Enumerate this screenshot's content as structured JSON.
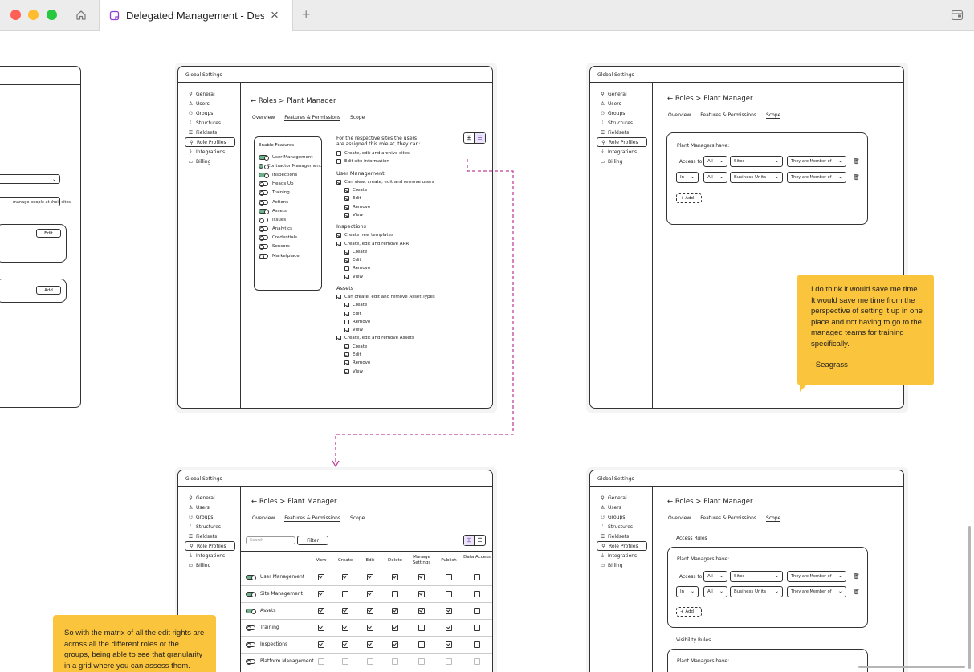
{
  "window": {
    "tab_title": "Delegated Management - Design",
    "colors": {
      "close": "#fe5f57",
      "minimize": "#febc2e",
      "zoom": "#28c840",
      "note": "#fbc43d",
      "connector": "#c0419b"
    }
  },
  "left_partial": {
    "select_text": "",
    "input_text": "manage people at their sites",
    "edit_label": "Edit",
    "add_label": "Add"
  },
  "sidebar": {
    "header": "Global Settings",
    "items": [
      "General",
      "Users",
      "Groups",
      "Structures",
      "Fieldsets",
      "Role Profiles",
      "Integrations",
      "Billing"
    ],
    "selected": "Role Profiles"
  },
  "frame1": {
    "breadcrumb": "← Roles > Plant Manager",
    "tabs": [
      "Overview",
      "Features & Permissions",
      "Scope"
    ],
    "active_tab": "Features & Permissions",
    "features_title": "Enable Features",
    "features": [
      {
        "label": "User Management",
        "on": true
      },
      {
        "label": "Contractor Management",
        "on": true
      },
      {
        "label": "Inspections",
        "on": true
      },
      {
        "label": "Heads Up",
        "on": false
      },
      {
        "label": "Training",
        "on": false
      },
      {
        "label": "Actions",
        "on": false
      },
      {
        "label": "Assets",
        "on": true
      },
      {
        "label": "Issues",
        "on": false
      },
      {
        "label": "Analytics",
        "on": false
      },
      {
        "label": "Credentials",
        "on": false
      },
      {
        "label": "Sensors",
        "on": false
      },
      {
        "label": "Marketplace",
        "on": false
      }
    ],
    "intro_line1": "For the respective sites the users",
    "intro_line2": "are assigned this role at, they can:",
    "site_perms": [
      {
        "label": "Create, edit and archive sites",
        "checked": false
      },
      {
        "label": "Edit site information",
        "checked": false
      }
    ],
    "sections": [
      {
        "title": "User Management",
        "groups": [
          {
            "label": "Can view, create, edit and remove users",
            "checked": true,
            "subs": [
              {
                "label": "Create",
                "checked": true
              },
              {
                "label": "Edit",
                "checked": true
              },
              {
                "label": "Remove",
                "checked": true
              },
              {
                "label": "View",
                "checked": true
              }
            ]
          }
        ]
      },
      {
        "title": "Inspections",
        "groups": [
          {
            "label": "Create new templates",
            "checked": true,
            "subs": []
          },
          {
            "label": "Create, edit and remove ARR",
            "checked": true,
            "subs": [
              {
                "label": "Create",
                "checked": true
              },
              {
                "label": "Edit",
                "checked": true
              },
              {
                "label": "Remove",
                "checked": false
              },
              {
                "label": "View",
                "checked": true
              }
            ]
          }
        ]
      },
      {
        "title": "Assets",
        "groups": [
          {
            "label": "Can create, edit and remove Asset Types",
            "checked": true,
            "subs": [
              {
                "label": "Create",
                "checked": true
              },
              {
                "label": "Edit",
                "checked": true
              },
              {
                "label": "Remove",
                "checked": false
              },
              {
                "label": "View",
                "checked": true
              }
            ]
          },
          {
            "label": "Create, edit and remove Assets",
            "checked": true,
            "subs": [
              {
                "label": "Create",
                "checked": true
              },
              {
                "label": "Edit",
                "checked": true
              },
              {
                "label": "Remove",
                "checked": true
              },
              {
                "label": "View",
                "checked": true
              }
            ]
          }
        ]
      }
    ]
  },
  "frame2": {
    "breadcrumb": "← Roles > Plant Manager",
    "tabs": [
      "Overview",
      "Features & Permissions",
      "Scope"
    ],
    "active_tab": "Scope",
    "box_title": "Plant Managers have:",
    "rules": [
      {
        "prefix": "Access to",
        "qty": "All",
        "entity": "Sites",
        "cond": "They are Member of"
      },
      {
        "prefix": "In",
        "qty": "All",
        "entity": "Business Units",
        "cond": "They are Member of"
      }
    ],
    "add_label": "+ Add"
  },
  "note1": {
    "text": "I do think it would save me time. It would save me time from the perspective of setting it up in one place and not having to go to the managed teams for training specifically.",
    "author": "- Seagrass"
  },
  "frame3": {
    "breadcrumb": "← Roles > Plant Manager",
    "tabs": [
      "Overview",
      "Features & Permissions",
      "Scope"
    ],
    "active_tab": "Features & Permissions",
    "search_placeholder": "Search",
    "filter_label": "Filter",
    "columns": [
      "View",
      "Create",
      "Edit",
      "Delete",
      "Manage Settings",
      "Publish",
      "Data Access"
    ],
    "rows": [
      {
        "label": "User Management",
        "on": true,
        "cells": [
          true,
          true,
          true,
          true,
          true,
          false,
          false
        ]
      },
      {
        "label": "Site Management",
        "on": true,
        "cells": [
          true,
          false,
          true,
          false,
          true,
          false,
          false
        ]
      },
      {
        "label": "Assets",
        "on": true,
        "cells": [
          true,
          true,
          true,
          true,
          true,
          true,
          false
        ]
      },
      {
        "label": "Training",
        "on": false,
        "cells": [
          true,
          true,
          true,
          true,
          false,
          true,
          false
        ]
      },
      {
        "label": "Inspections",
        "on": false,
        "cells": [
          true,
          true,
          true,
          true,
          false,
          true,
          false
        ]
      },
      {
        "label": "Platform Management",
        "on": false,
        "cells": [
          false,
          false,
          false,
          false,
          false,
          false,
          false
        ]
      }
    ]
  },
  "note2": {
    "text": "So with the matrix of all the edit rights are across all the different roles or the groups, being able to see that granularity in a grid where you can assess them. You"
  },
  "frame4": {
    "breadcrumb": "← Roles > Plant Manager",
    "tabs": [
      "Overview",
      "Features & Permissions",
      "Scope"
    ],
    "active_tab": "Scope",
    "access_rules_label": "Access Rules",
    "box_title": "Plant Managers have:",
    "rules": [
      {
        "prefix": "Access to",
        "qty": "All",
        "entity": "Sites",
        "cond": "They are Member of"
      },
      {
        "prefix": "In",
        "qty": "All",
        "entity": "Business Units",
        "cond": "They are Member of"
      }
    ],
    "add_label": "+ Add",
    "visibility_label": "Visibility Rules",
    "box2_title": "Plant Managers have:"
  }
}
